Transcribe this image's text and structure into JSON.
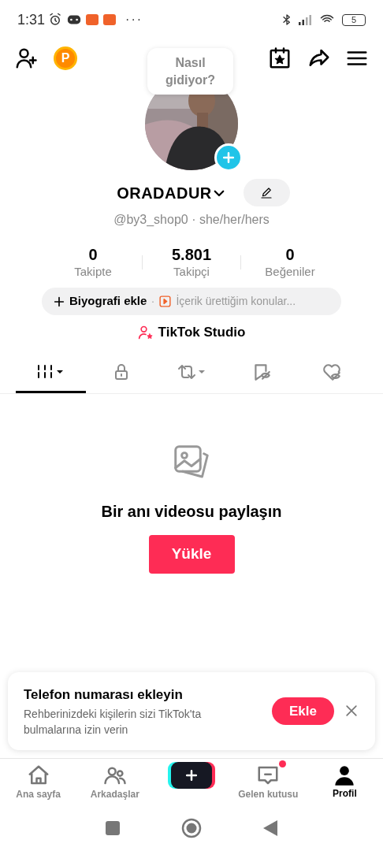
{
  "status_bar": {
    "time": "1:31",
    "more": "···",
    "battery": "5"
  },
  "header": {
    "coins": "P"
  },
  "bubble": {
    "text": "Nasıl gidiyor?"
  },
  "profile": {
    "name": "ORADADUR",
    "handle": "@by3_shop0 · she/her/hers"
  },
  "stats": [
    {
      "value": "0",
      "label": "Takipte"
    },
    {
      "value": "5.801",
      "label": "Takipçi"
    },
    {
      "value": "0",
      "label": "Beğeniler"
    }
  ],
  "bio": {
    "add": "Biyografi ekle",
    "separator": "·",
    "topics": "İçerik ürettiğim konular..."
  },
  "studio": {
    "label": "TikTok Studio"
  },
  "tabs": [
    {
      "selected": true
    },
    {
      "selected": false
    },
    {
      "selected": false
    },
    {
      "selected": false
    },
    {
      "selected": false
    }
  ],
  "empty": {
    "title": "Bir anı videosu paylaşın",
    "button": "Yükle"
  },
  "banner": {
    "title": "Telefon numarası ekleyin",
    "text": "Rehberinizdeki kişilerin sizi TikTok'ta bulmalarına izin verin",
    "button": "Ekle"
  },
  "nav": [
    {
      "kind": "tab",
      "label": "Ana sayfa",
      "selected": false,
      "unread": false
    },
    {
      "kind": "tab",
      "label": "Arkadaşlar",
      "selected": false,
      "unread": false
    },
    {
      "kind": "create"
    },
    {
      "kind": "tab",
      "label": "Gelen kutusu",
      "selected": false,
      "unread": true
    },
    {
      "kind": "tab",
      "label": "Profil",
      "selected": true,
      "unread": false
    }
  ]
}
